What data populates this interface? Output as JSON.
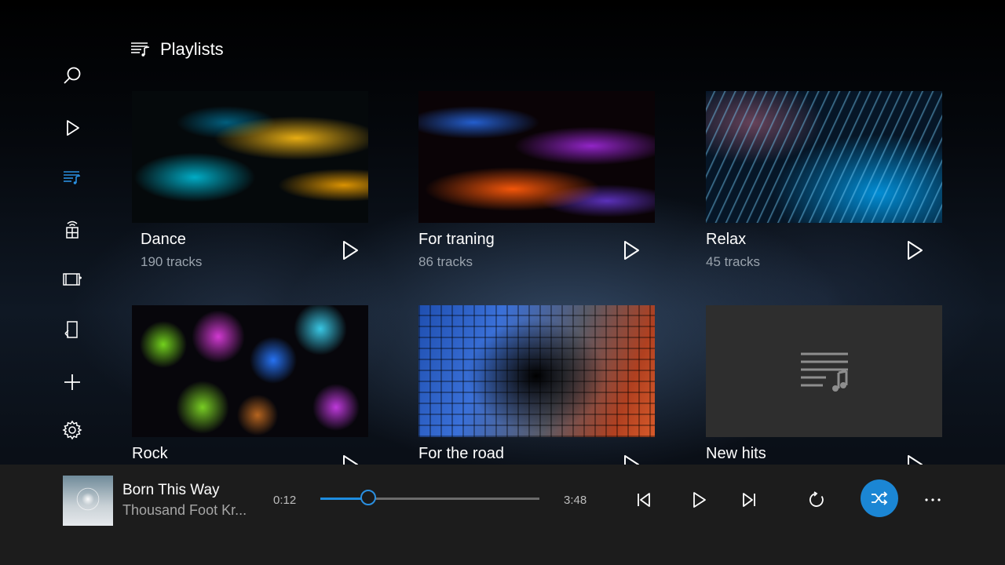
{
  "header": {
    "title": "Playlists",
    "icon": "playlist-icon"
  },
  "rail": [
    {
      "name": "search",
      "icon": "search-icon"
    },
    {
      "name": "now-playing",
      "icon": "play-icon"
    },
    {
      "name": "playlists",
      "icon": "playlist-icon",
      "active": true
    },
    {
      "name": "network",
      "icon": "network-icon"
    },
    {
      "name": "video",
      "icon": "video-icon"
    },
    {
      "name": "music",
      "icon": "music-file-icon"
    },
    {
      "name": "add",
      "icon": "plus-icon"
    },
    {
      "name": "settings",
      "icon": "gear-icon"
    }
  ],
  "playlists": [
    {
      "name": "Dance",
      "count": "190 tracks"
    },
    {
      "name": "For traning",
      "count": "86 tracks"
    },
    {
      "name": "Relax",
      "count": "45 tracks"
    },
    {
      "name": "Rock",
      "count": ""
    },
    {
      "name": "For the road",
      "count": ""
    },
    {
      "name": "New hits",
      "count": ""
    }
  ],
  "player": {
    "title": "Born This Way",
    "artist": "Thousand Foot Kr...",
    "elapsed": "0:12",
    "duration": "3:48",
    "progress": 0.22,
    "shuffle": true
  },
  "colors": {
    "accent": "#1b86d4",
    "inactive_icon": "#ffffff"
  }
}
